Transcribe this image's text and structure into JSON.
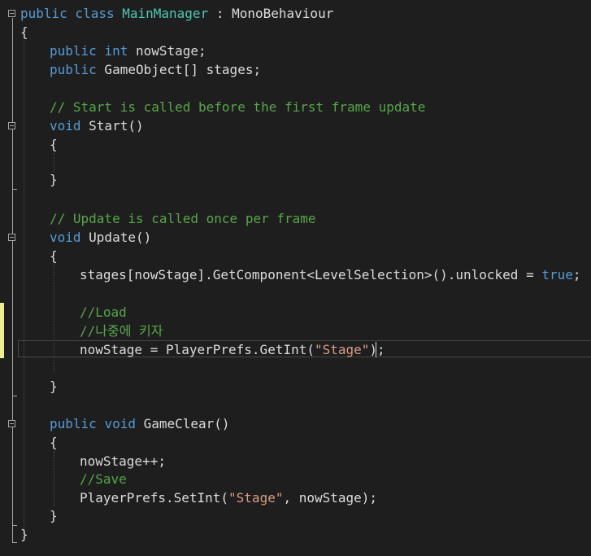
{
  "editor": {
    "lines": {
      "l1": {
        "kw": "public class ",
        "ty": "MainManager",
        "rest": " : MonoBehaviour"
      },
      "l2": {
        "text": "{"
      },
      "l3": {
        "kw1": "public ",
        "kw2": "int",
        "rest": " nowStage;"
      },
      "l4": {
        "kw": "public",
        "rest": " GameObject[] stages;"
      },
      "l6": {
        "comment": "// Start is called before the first frame update"
      },
      "l7": {
        "kw": "void",
        "rest": " Start()"
      },
      "l8": {
        "text": "{"
      },
      "l10": {
        "text": "}"
      },
      "l12": {
        "comment": "// Update is called once per frame"
      },
      "l13": {
        "kw": "void",
        "rest": " Update()"
      },
      "l14": {
        "text": "{"
      },
      "l15": {
        "pre": "stages[nowStage].GetComponent<LevelSelection>().unlocked = ",
        "kw": "true",
        "post": ";"
      },
      "l17": {
        "comment": "//Load"
      },
      "l18": {
        "comment": "//나중에 키자"
      },
      "l19": {
        "pre": "nowStage = PlayerPrefs.GetInt(",
        "str": "\"Stage\"",
        "post": ");"
      },
      "l21": {
        "text": "}"
      },
      "l23": {
        "kw1": "public ",
        "kw2": "void",
        "rest": " GameClear()"
      },
      "l24": {
        "text": "{"
      },
      "l25": {
        "text": "nowStage++;"
      },
      "l26": {
        "comment": "//Save"
      },
      "l27": {
        "pre": "PlayerPrefs.SetInt(",
        "str": "\"Stage\"",
        "post": ", nowStage);"
      },
      "l28": {
        "text": "}"
      },
      "l29": {
        "text": "}"
      }
    }
  },
  "colors": {
    "background": "#1e1e1e",
    "keyword": "#569cd6",
    "type": "#4ec9b0",
    "comment": "#57a64a",
    "string": "#d69d85",
    "text": "#dcdcdc",
    "change_marker": "#efef91"
  },
  "icons": {
    "fold": "collapse-minus-icon"
  }
}
